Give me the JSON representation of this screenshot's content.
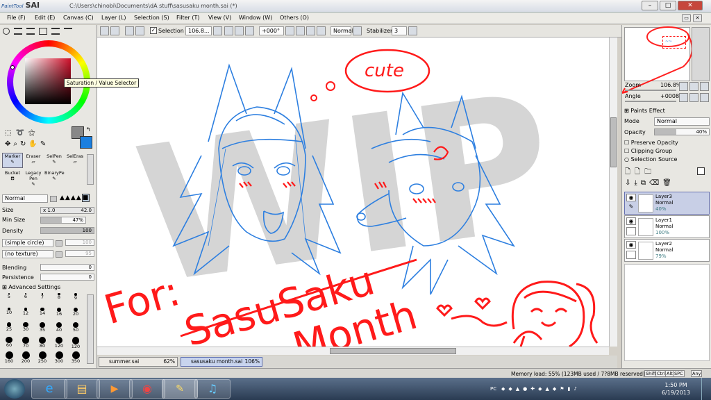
{
  "window": {
    "logo_small": "PaintTool",
    "logo": "SAI",
    "title": "C:\\Users\\chinobi\\Documents\\dA stuff\\sasusaku month.sai (*)"
  },
  "menu": [
    "File (F)",
    "Edit (E)",
    "Canvas (C)",
    "Layer (L)",
    "Selection (S)",
    "Filter (T)",
    "View (V)",
    "Window (W)",
    "Others (O)"
  ],
  "toolbar": {
    "selection_label": "Selection",
    "zoom": "106.8...",
    "angle": "+000°",
    "mode": "Normal",
    "stabilizer_label": "Stabilizer",
    "stabilizer": "3"
  },
  "color": {
    "tooltip": "Saturation / Value Selector",
    "primary": "#888888",
    "secondary": "#1a7fe0"
  },
  "tools": [
    "Marker",
    "Eraser",
    "SelPen",
    "SelEras",
    "Bucket",
    "Legacy Pen",
    "BinaryPe"
  ],
  "brush": {
    "blend_mode": "Normal",
    "size_label": "Size",
    "size_mult": "x 1.0",
    "size": "42.0",
    "min_size_label": "Min Size",
    "min_size": "47%",
    "min_size_fraction": 0.47,
    "density_label": "Density",
    "density": "100",
    "shape": "(simple circle)",
    "shape_value": "100",
    "texture": "(no texture)",
    "blending_label": "Blending",
    "blending": "0",
    "persistence_label": "Persistence",
    "persistence": "0",
    "advanced": "Advanced Settings"
  },
  "brush_sizes": [
    "5",
    "6",
    "7",
    "8",
    "9",
    "10",
    "12",
    "14",
    "16",
    "20",
    "25",
    "30",
    "35",
    "40",
    "50",
    "60",
    "70",
    "80",
    "120",
    "120",
    "160",
    "200",
    "250",
    "300",
    "350"
  ],
  "navigator": {
    "zoom_label": "Zoom",
    "zoom": "106.8%",
    "angle_label": "Angle",
    "angle": "+0008"
  },
  "layer_panel": {
    "paints_effect": "Paints Effect",
    "mode_label": "Mode",
    "mode": "Normal",
    "opacity_label": "Opacity",
    "opacity": "40%",
    "opacity_fraction": 0.4,
    "preserve_opacity": "Preserve Opacity",
    "clipping_group": "Clipping Group",
    "selection_source": "Selection Source"
  },
  "layers": [
    {
      "name": "Layer3",
      "mode": "Normal",
      "opacity": "40%"
    },
    {
      "name": "Layer1",
      "mode": "Normal",
      "opacity": "100%"
    },
    {
      "name": "Layer2",
      "mode": "Normal",
      "opacity": "79%"
    }
  ],
  "canvas_text": {
    "watermark": "WIP",
    "cute": "cute",
    "for": "For:",
    "line1": "SasuSaku",
    "line2": "Month"
  },
  "doc_tabs": [
    {
      "name": "summer.sai",
      "zoom": "62%"
    },
    {
      "name": "sasusaku month.sai",
      "zoom": "106%"
    }
  ],
  "status": {
    "memory": "Memory load: 55% (123MB used / 7?8MB reserved)",
    "keys": [
      "Shift",
      "Ctrl",
      "Alt",
      "SPC",
      "Any"
    ]
  },
  "taskbar": {
    "time": "1:50 PM",
    "date": "6/19/2013",
    "tray": "PC"
  }
}
